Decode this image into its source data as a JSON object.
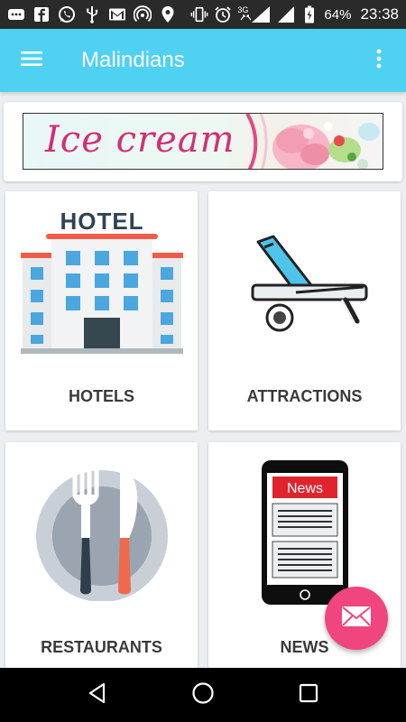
{
  "status_bar": {
    "battery": "64%",
    "time": "23:38",
    "network": "3G"
  },
  "app_bar": {
    "title": "Malindians"
  },
  "banner": {
    "text": "Ice cream"
  },
  "tiles": [
    {
      "label": "HOTELS",
      "image_text": "HOTEL"
    },
    {
      "label": "ATTRACTIONS"
    },
    {
      "label": "RESTAURANTS"
    },
    {
      "label": "NEWS",
      "image_text": "News"
    }
  ],
  "colors": {
    "app_bar": "#4fd1f2",
    "fab": "#f0457f",
    "banner_text": "#d42e74"
  }
}
